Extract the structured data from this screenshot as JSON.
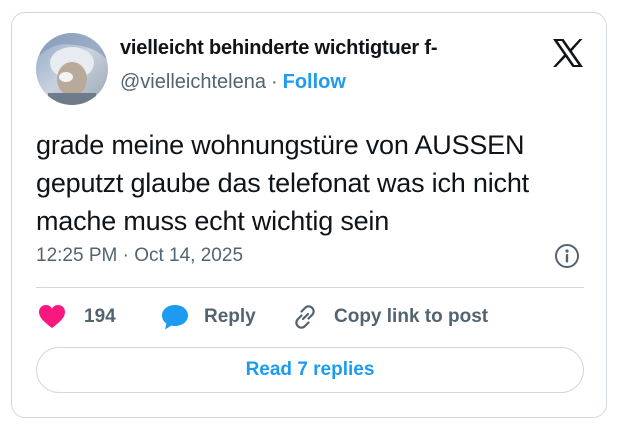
{
  "author": {
    "display_name": "vielleicht behinderte wichtigtuer f-",
    "handle": "@vielleichtelena",
    "separator": "·",
    "follow_label": "Follow"
  },
  "platform_icon": "x-logo-icon",
  "tweet": {
    "text": "grade meine wohnungstüre von AUSSEN geputzt glaube das telefonat was ich nicht mache muss echt wichtig sein",
    "timestamp": "12:25 PM · Oct 14, 2025"
  },
  "actions": {
    "like_count": "194",
    "reply_label": "Reply",
    "copy_label": "Copy link to post"
  },
  "read_replies_label": "Read 7 replies",
  "colors": {
    "accent": "#1d9bf0",
    "like": "#f91880",
    "text": "#0f1419",
    "muted": "#536471",
    "border": "#cfd9de"
  }
}
